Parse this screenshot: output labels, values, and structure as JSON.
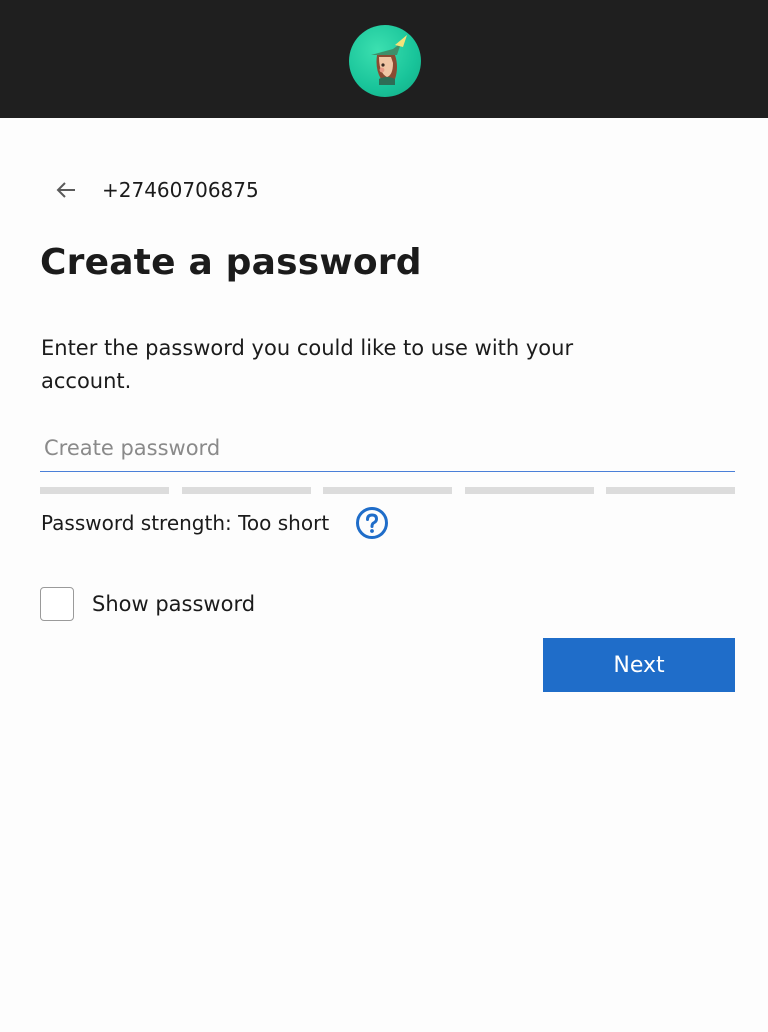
{
  "header": {
    "avatar_icon": "explorer-character-icon"
  },
  "identity": {
    "back_icon": "arrow-left-icon",
    "phone": "+27460706875"
  },
  "main": {
    "title": "Create a password",
    "description": "Enter the password you could like to use with your account.",
    "password_placeholder": "Create password",
    "password_value": "",
    "strength_label": "Password strength: Too short",
    "strength_segments_filled": 0,
    "strength_segments_total": 5,
    "help_icon": "question-circle-icon",
    "show_password_label": "Show password",
    "show_password_checked": false,
    "next_label": "Next"
  },
  "colors": {
    "accent": "#1f6dc9",
    "topbar": "#1f1f1f",
    "avatar_bg": "#19c49a",
    "input_underline": "#4a7fd8",
    "meter_empty": "#dcdcdc"
  }
}
